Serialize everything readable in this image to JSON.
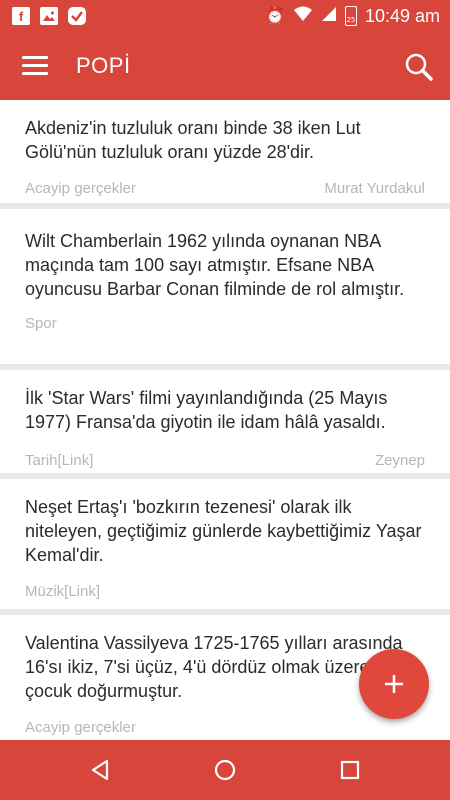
{
  "status_bar": {
    "left_icons": [
      "facebook-icon",
      "image-icon",
      "check-icon"
    ],
    "right_icons": [
      "alarm-icon",
      "wifi-icon",
      "signal-icon",
      "battery-icon"
    ],
    "battery": "25",
    "time": "10:49 am"
  },
  "app_bar": {
    "title": "POPİ"
  },
  "facts": [
    {
      "text": "Akdeniz'in tuzluluk oranı binde 38 iken Lut Gölü'nün tuzluluk oranı yüzde 28'dir.",
      "category": "Acayip gerçekler",
      "author": "Murat Yurdakul"
    },
    {
      "text": "Wilt Chamberlain 1962 yılında oynanan NBA maçında tam 100 sayı atmıştır. Efsane NBA oyuncusu Barbar Conan filminde de rol almıştır.",
      "category": "Spor",
      "author": ""
    },
    {
      "text": "İlk 'Star Wars' filmi yayınlandığında (25 Mayıs 1977) Fransa'da giyotin ile idam hâlâ yasaldı.",
      "category": "Tarih[Link]",
      "author": "Zeynep"
    },
    {
      "text": "Neşet Ertaş'ı 'bozkırın tezenesi' olarak ilk niteleyen, geçtiğimiz günlerde kaybettiğimiz Yaşar Kemal'dir.",
      "category": "Müzik[Link]",
      "author": ""
    },
    {
      "text": "Valentina Vassilyeva 1725-1765 yılları arasında 16'sı ikiz, 7'si üçüz, 4'ü dördüz olmak üzere 69 çocuk doğurmuştur.",
      "category": "Acayip gerçekler",
      "author": ""
    }
  ],
  "fab": {
    "icon": "plus-icon"
  },
  "nav_bar": {
    "icons": [
      "back-icon",
      "home-icon",
      "recents-icon"
    ]
  }
}
